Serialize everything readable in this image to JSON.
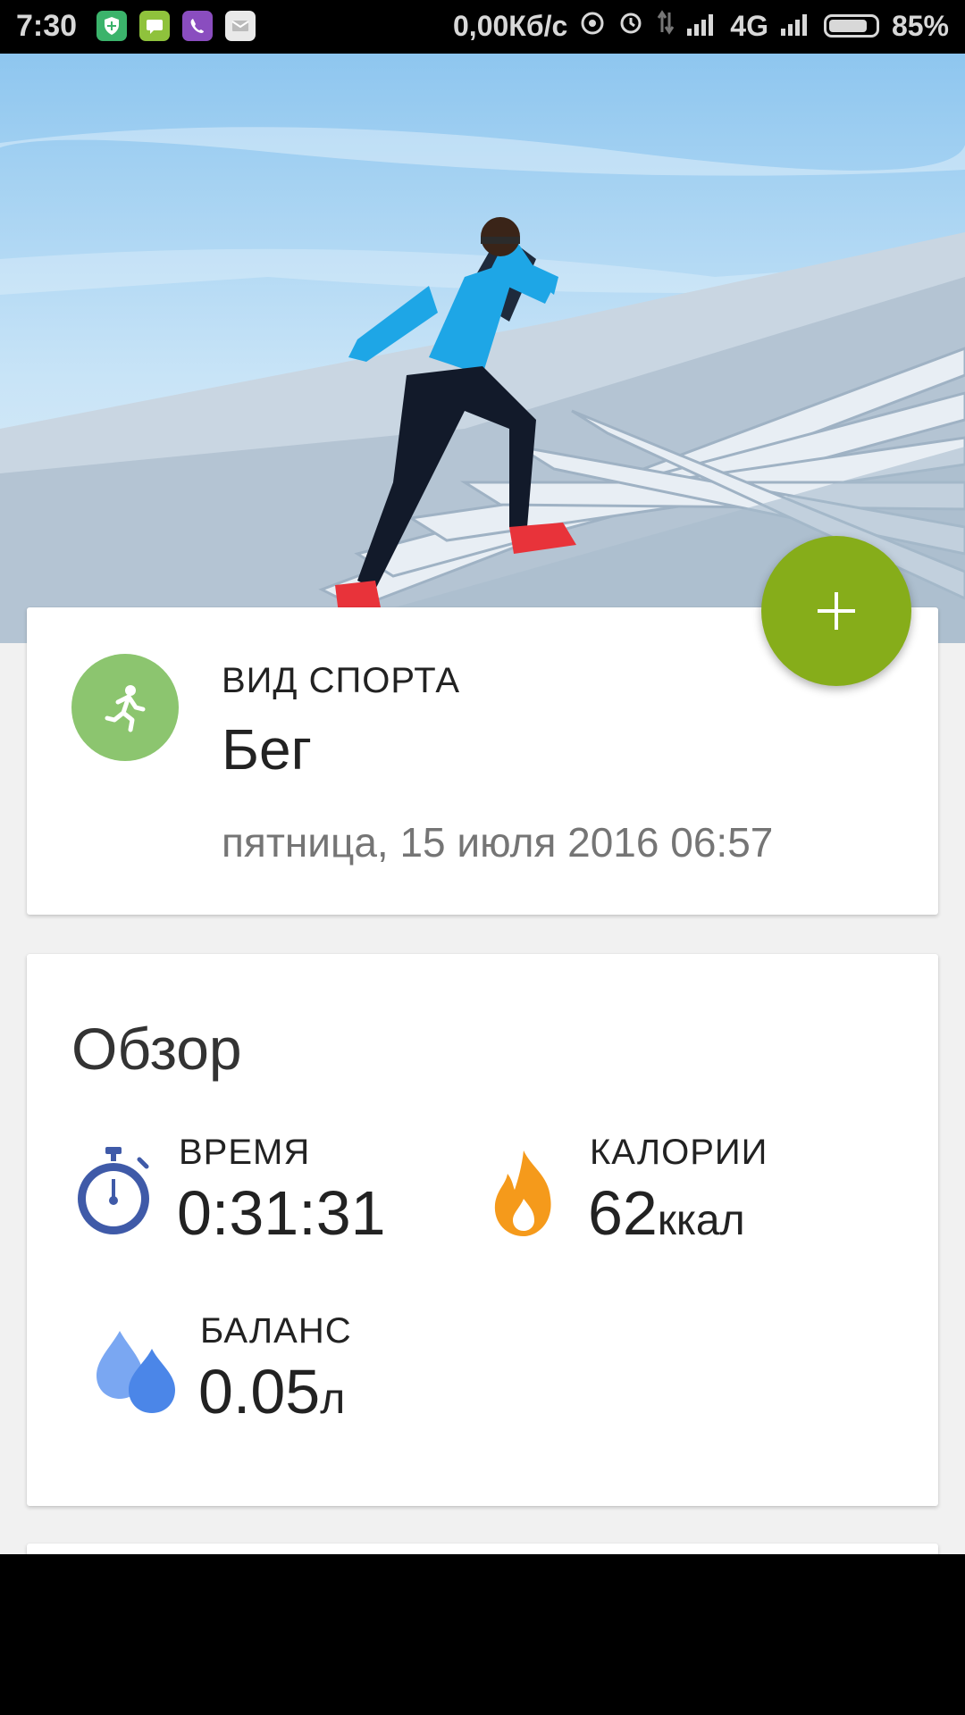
{
  "status_bar": {
    "time": "7:30",
    "network_speed": "0,00Кб/с",
    "network_type": "4G",
    "battery_percent": "85%",
    "battery_level": 0.85,
    "app_icons": [
      "security-app-icon",
      "sms-app-icon",
      "viber-icon",
      "email-icon"
    ]
  },
  "hero": {
    "sky_color": "#a9d3f1",
    "jacket_color": "#1ea6e6",
    "shoe_color": "#e8333a"
  },
  "workout": {
    "sport_label": "ВИД СПОРТА",
    "sport_value": "Бег",
    "datetime": "пятница, 15 июля 2016 06:57",
    "sport_icon": "running-man-icon",
    "sport_icon_color": "#8cc56f"
  },
  "fab": {
    "label": "+",
    "color": "#86ad1a"
  },
  "overview": {
    "title": "Обзор",
    "time": {
      "label": "ВРЕМЯ",
      "value": "0:31:31",
      "icon": "stopwatch-icon",
      "icon_color": "#3f5aa8"
    },
    "calories": {
      "label": "КАЛОРИИ",
      "value": "62",
      "unit": "ккал",
      "icon": "flame-icon",
      "icon_color": "#f59a1b"
    },
    "balance": {
      "label": "БАЛАНС",
      "value": "0.05",
      "unit": "л",
      "icon": "water-drops-icon",
      "icon_color": "#4b86e8"
    }
  }
}
